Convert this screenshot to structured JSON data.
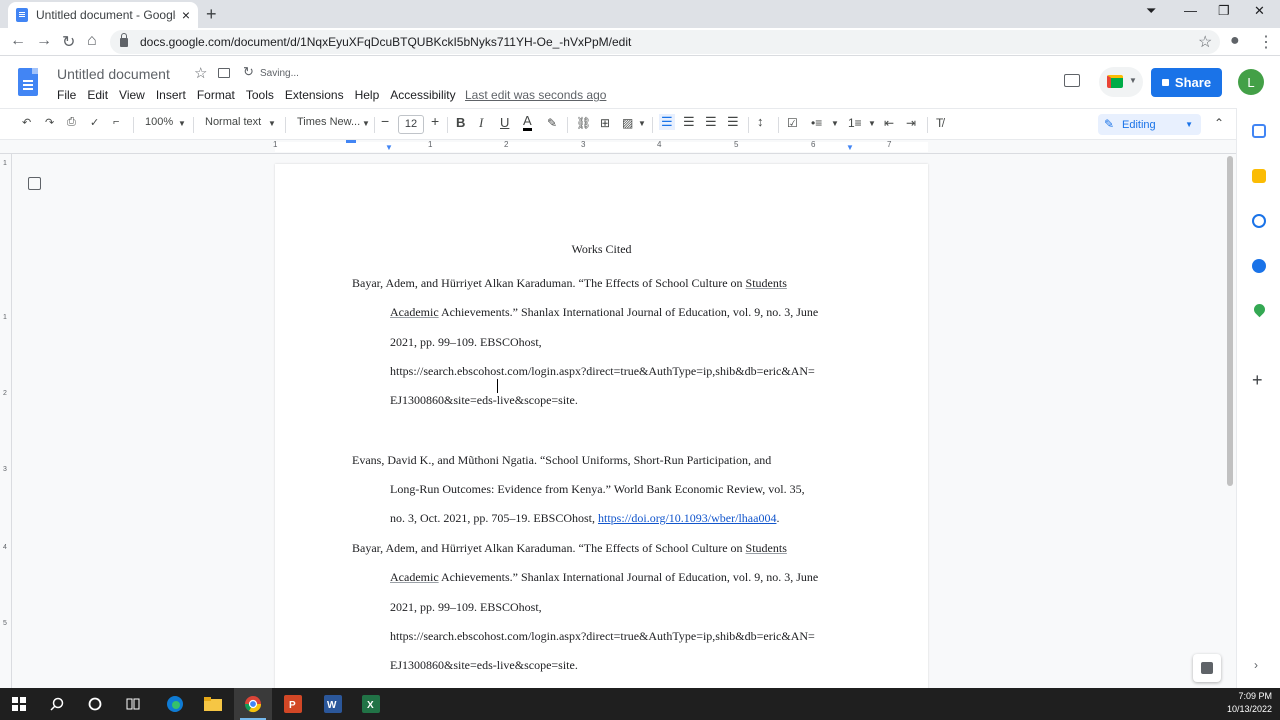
{
  "browser": {
    "tab_title": "Untitled document - Google Docs",
    "url": "docs.google.com/document/d/1NqxEyuXFqDcuBTQUBKckI5bNyks711YH-Oe_-hVxPpM/edit"
  },
  "docs": {
    "title": "Untitled document",
    "save_status": "Saving...",
    "last_edit": "Last edit was seconds ago",
    "menu": [
      "File",
      "Edit",
      "View",
      "Insert",
      "Format",
      "Tools",
      "Extensions",
      "Help",
      "Accessibility"
    ],
    "share_label": "Share",
    "avatar_letter": "L",
    "toolbar": {
      "zoom": "100%",
      "style": "Normal text",
      "font": "Times New...",
      "font_size": "12",
      "mode": "Editing"
    },
    "ruler_numbers": [
      "1",
      "1",
      "2",
      "3",
      "4",
      "5",
      "6",
      "7"
    ],
    "vruler_numbers": [
      "1",
      "1",
      "2",
      "3",
      "4",
      "5"
    ]
  },
  "document": {
    "heading": "Works Cited",
    "entries": [
      {
        "lines": [
          "Bayar, Adem, and Hürriyet Alkan Karaduman. “The Effects of School Culture on ",
          "",
          "2021, pp. 99–109. EBSCOhost,",
          "https://search.ebscohost.com/login.aspx?direct=true&AuthType=ip,shib&db=eric&AN=",
          "EJ1300860&site=eds-live&scope=site."
        ],
        "squiggle_1": "Students",
        "squiggle_2": "Academic",
        "line2_rest": " Achievements.” Shanlax International Journal of Education, vol. 9, no. 3, June"
      },
      {
        "lines": [
          "Evans, David K., and Mũthoni Ngatia. “School Uniforms, Short-Run Participation, and",
          "Long-Run Outcomes: Evidence from Kenya.” World Bank Economic Review, vol. 35,",
          "no. 3, Oct. 2021, pp. 705–19. EBSCOhost, "
        ],
        "link": "https://doi.org/10.1093/wber/lhaa004",
        "link_tail": "."
      },
      {
        "lines": [
          "Bayar, Adem, and Hürriyet Alkan Karaduman. “The Effects of School Culture on ",
          "",
          "2021, pp. 99–109. EBSCOhost,",
          "https://search.ebscohost.com/login.aspx?direct=true&AuthType=ip,shib&db=eric&AN=",
          "EJ1300860&site=eds-live&scope=site."
        ],
        "squiggle_1": "Students",
        "squiggle_2": "Academic",
        "line2_rest": " Achievements.” Shanlax International Journal of Education, vol. 9, no. 3, June"
      }
    ]
  },
  "taskbar": {
    "time": "7:09 PM",
    "date": "10/13/2022"
  },
  "colors": {
    "accent": "#1a73e8",
    "docs_blue": "#4285f4",
    "avatar": "#43a047"
  }
}
